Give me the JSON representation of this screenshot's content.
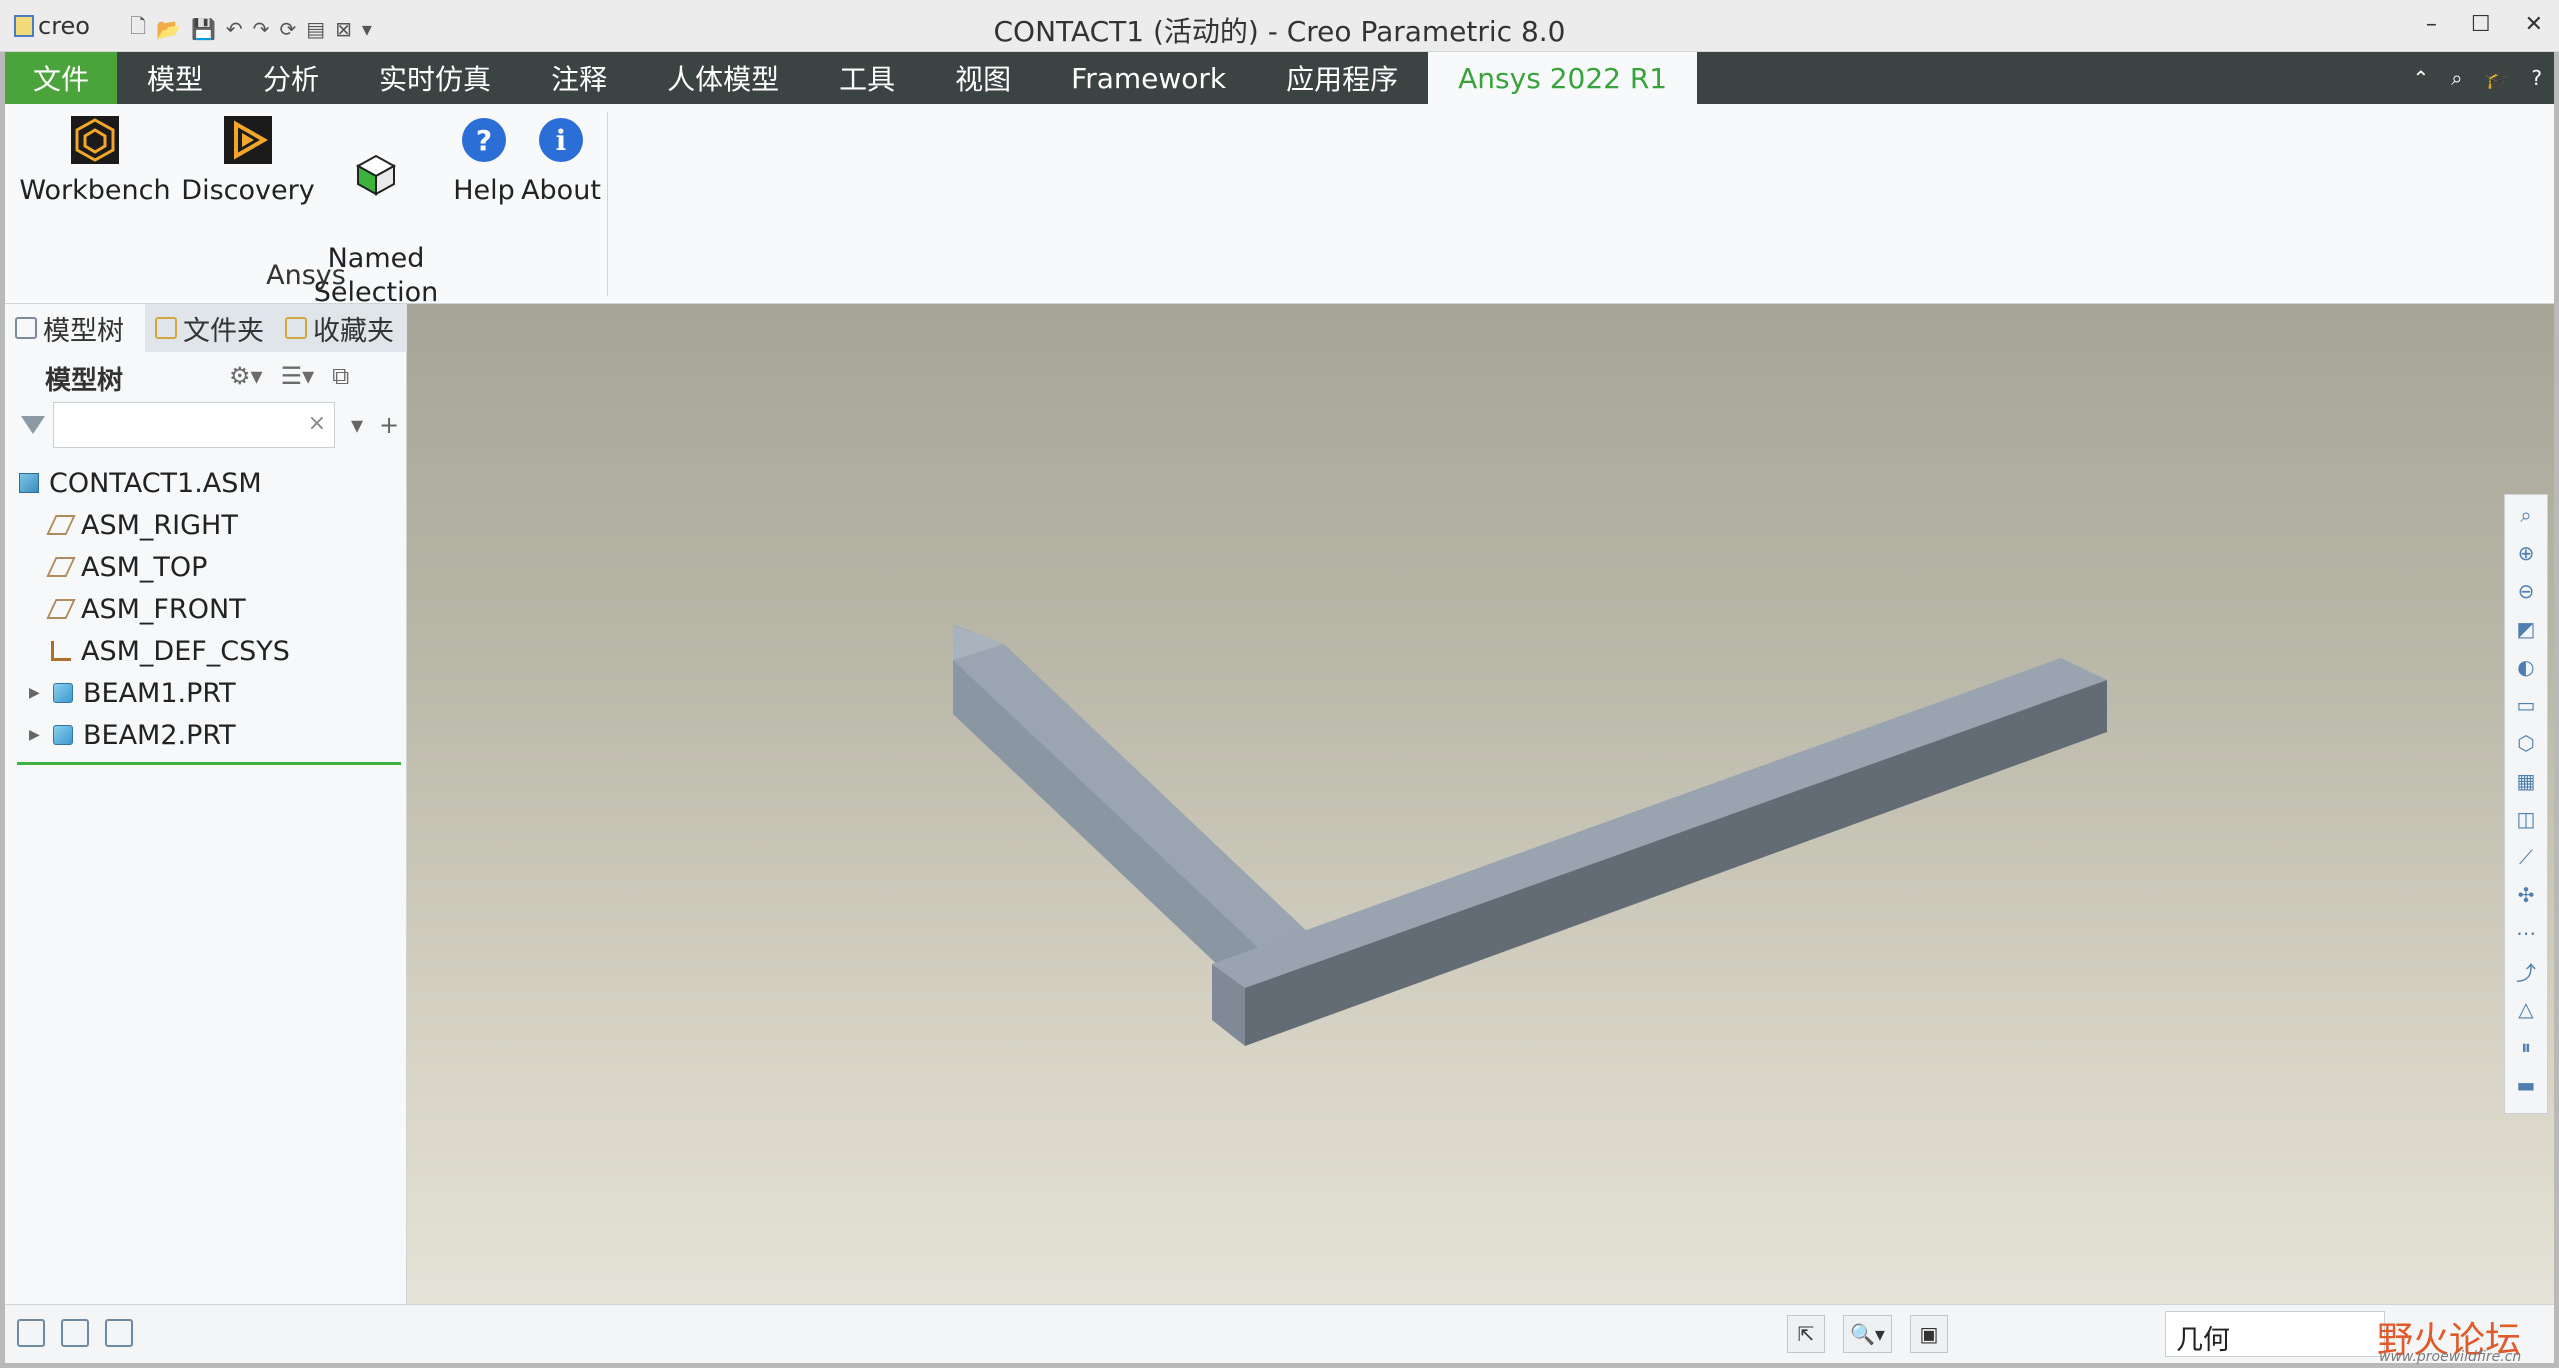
{
  "window": {
    "title": "CONTACT1 (活动的) - Creo Parametric 8.0",
    "app_logo": "creo",
    "controls": [
      "–",
      "☐",
      "✕"
    ]
  },
  "ribbon_tabs": [
    "文件",
    "模型",
    "分析",
    "实时仿真",
    "注释",
    "人体模型",
    "工具",
    "视图",
    "Framework",
    "应用程序",
    "Ansys 2022 R1"
  ],
  "active_tab": "Ansys 2022 R1",
  "ribbon_buttons": [
    {
      "label": "Workbench"
    },
    {
      "label": "Discovery"
    },
    {
      "label": "Named\nSelection"
    },
    {
      "label": "Help"
    },
    {
      "label": "About"
    }
  ],
  "ribbon_group_label": "Ansys",
  "left_panel": {
    "tabs": [
      "模型树",
      "文件夹",
      "收藏夹"
    ],
    "tree_title": "模型树",
    "search_placeholder": "",
    "tree": [
      {
        "label": "CONTACT1.ASM",
        "type": "assembly"
      },
      {
        "label": "ASM_RIGHT",
        "type": "datum-plane"
      },
      {
        "label": "ASM_TOP",
        "type": "datum-plane"
      },
      {
        "label": "ASM_FRONT",
        "type": "datum-plane"
      },
      {
        "label": "ASM_DEF_CSYS",
        "type": "coordinate-system"
      },
      {
        "label": "BEAM1.PRT",
        "type": "part",
        "expandable": true
      },
      {
        "label": "BEAM2.PRT",
        "type": "part",
        "expandable": true
      }
    ]
  },
  "status_bar": {
    "selection_filter": "几何",
    "watermark": "野火论坛",
    "watermark_sub": "www.proewildfire.cn"
  },
  "colors": {
    "accent_green": "#4aa33b",
    "tabbar_dark": "#3c4343",
    "active_tab_text": "#37a33a"
  }
}
